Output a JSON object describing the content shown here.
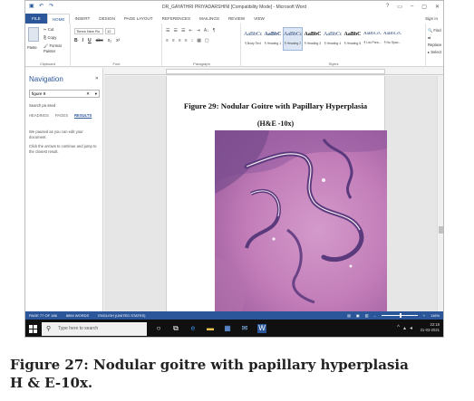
{
  "window": {
    "title": "DR_GAYATHRI PRIYADARSHINI [Compatibility Mode] - Microsoft Word",
    "controls": [
      "?",
      "▭",
      "–",
      "▢",
      "✕"
    ]
  },
  "quick_access": [
    "save-icon",
    "undo-icon",
    "redo-icon"
  ],
  "ribbon_tabs": [
    "FILE",
    "HOME",
    "INSERT",
    "DESIGN",
    "PAGE LAYOUT",
    "REFERENCES",
    "MAILINGS",
    "REVIEW",
    "VIEW"
  ],
  "sign_in": "Sign in",
  "clipboard": {
    "paste": "Paste",
    "cut": "Cut",
    "copy": "Copy",
    "format_painter": "Format Painter",
    "group": "Clipboard"
  },
  "font": {
    "family": "Times New Ro",
    "size": "12",
    "format_buttons": [
      "B",
      "I",
      "U",
      "abc",
      "x₂",
      "x²"
    ],
    "group": "Font"
  },
  "paragraph": {
    "row1": [
      "☰",
      "☰",
      "☰",
      "⇤",
      "⇥",
      "A↓",
      "¶"
    ],
    "row2": [
      "≡",
      "≡",
      "≡",
      "≡",
      "↕",
      "▦",
      "▢"
    ],
    "group": "Paragraph"
  },
  "styles": {
    "items": [
      {
        "sample": "AaBbCcI",
        "name": "¶ Body Text"
      },
      {
        "sample": "AaBbC",
        "name": "¶ Heading 1"
      },
      {
        "sample": "AaBbCc",
        "name": "¶ Heading 2"
      },
      {
        "sample": "AaBbC",
        "name": "¶ Heading 3"
      },
      {
        "sample": "AaBbCc",
        "name": "¶ Heading 4"
      },
      {
        "sample": "AaBbC",
        "name": "¶ Heading 5"
      },
      {
        "sample": "AaBbCcC",
        "name": "¶ List Para..."
      },
      {
        "sample": "AaBbCcC",
        "name": "¶ No Spac..."
      }
    ],
    "selected_index": 2,
    "group": "Styles"
  },
  "editing": {
    "find": "Find",
    "replace": "Replace",
    "select": "Select",
    "group": "Editing"
  },
  "navigation": {
    "title": "Navigation",
    "search_value": "figure 9",
    "search_subtitle": "Search pa ssed",
    "tabs": [
      "HEADINGS",
      "PAGES",
      "RESULTS"
    ],
    "active_tab": "RESULTS",
    "message1": "We paused as you can edit your document.",
    "message2": "Click the arrows to continue and jump to the closest result."
  },
  "document": {
    "figure_title": "Figure 29: Nodular Goitre with Papillary Hyperplasia",
    "figure_stain": "(H&E -10x)"
  },
  "statusbar": {
    "page": "PAGE 77 OF 186",
    "words": "8894 WORDS",
    "language": "ENGLISH (UNITED STATES)",
    "zoom": "116%"
  },
  "taskbar": {
    "search_placeholder": "Type here to search",
    "time": "22:18",
    "date": "21-03-2021"
  },
  "caption": {
    "line1": "Figure 27: Nodular goitre with papillary hyperplasia",
    "line2": "H & E-10x."
  },
  "colors": {
    "accent": "#2b579a",
    "stain_pink": "#c889bd",
    "stain_purple": "#5a3a7c"
  }
}
